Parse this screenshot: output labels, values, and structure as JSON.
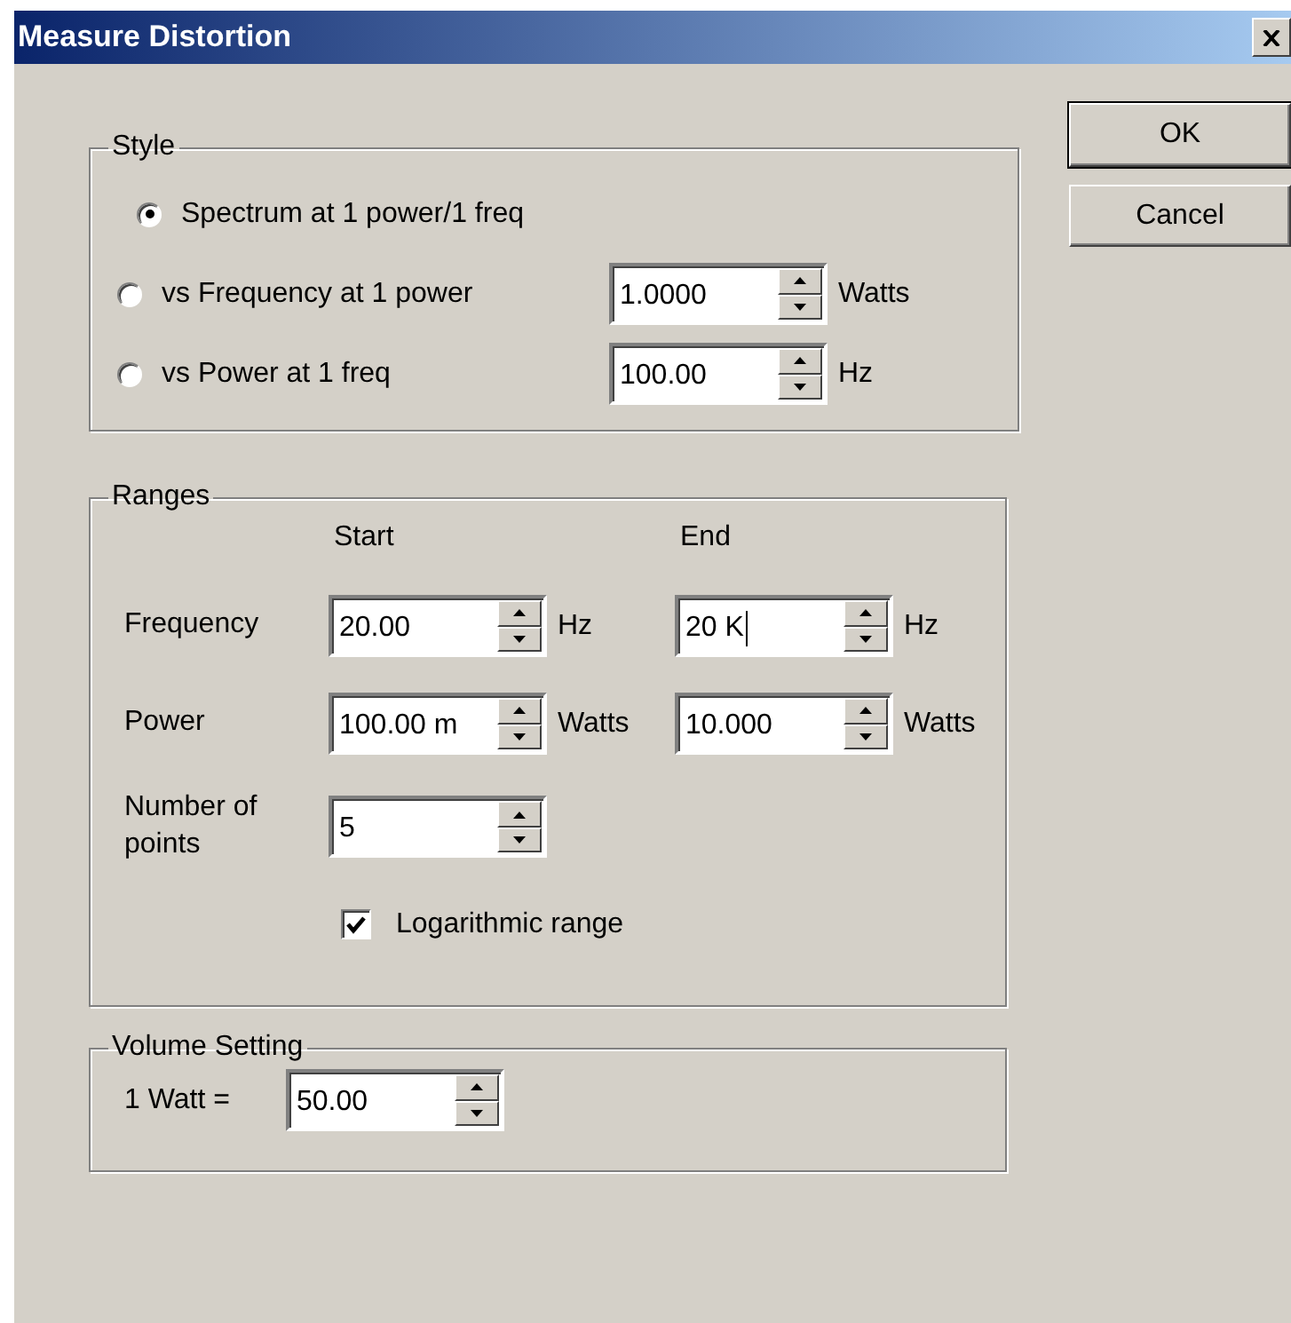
{
  "window": {
    "title": "Measure Distortion"
  },
  "style_group": {
    "title": "Style",
    "options": [
      {
        "label": "Spectrum at 1 power/1 freq",
        "selected": true
      },
      {
        "label": "vs Frequency at 1 power",
        "selected": false,
        "field": {
          "value": "1.0000",
          "unit": "Watts"
        }
      },
      {
        "label": "vs Power at 1 freq",
        "selected": false,
        "field": {
          "value": "100.00",
          "unit": "Hz"
        }
      }
    ]
  },
  "ranges_group": {
    "title": "Ranges",
    "headers": [
      "Start",
      "End"
    ],
    "rows": [
      {
        "label": "Frequency",
        "start": {
          "value": "20.00",
          "unit": "Hz"
        },
        "end": {
          "value": "20 K",
          "unit": "Hz",
          "focused": true
        }
      },
      {
        "label": "Power",
        "start": {
          "value": "100.00 m",
          "unit": "Watts"
        },
        "end": {
          "value": "10.000",
          "unit": "Watts"
        }
      },
      {
        "label": "Number of points",
        "start": {
          "value": "5"
        }
      }
    ],
    "logarithmic": {
      "label": "Logarithmic range",
      "checked": true
    }
  },
  "volume_group": {
    "title": "Volume Setting",
    "label": "1 Watt =",
    "field": {
      "value": "50.00"
    }
  },
  "buttons": [
    {
      "label": "OK",
      "default": true
    },
    {
      "label": "Cancel",
      "default": false
    }
  ]
}
